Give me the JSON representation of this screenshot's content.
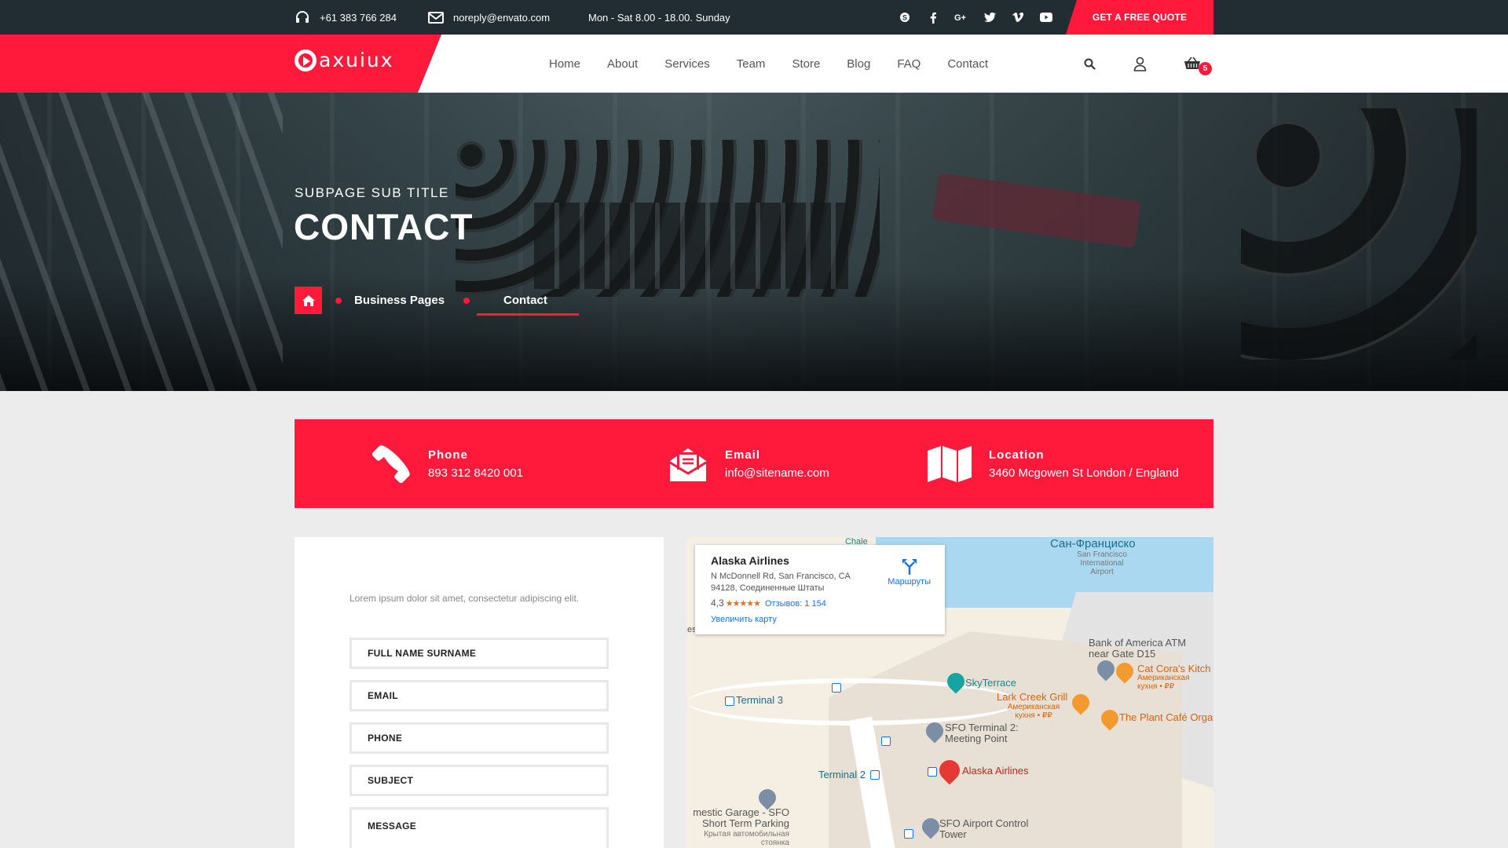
{
  "topbar": {
    "phone": "+61 383 766 284",
    "email": "noreply@envato.com",
    "hours": "Mon - Sat 8.00 - 18.00. Sunday",
    "socials": [
      "skype-icon",
      "facebook-icon",
      "google-plus-icon",
      "twitter-icon",
      "vimeo-icon",
      "youtube-icon"
    ],
    "quote_button": "GET A FREE QUOTE"
  },
  "header": {
    "logo": "axuiux",
    "nav": [
      "Home",
      "About",
      "Services",
      "Team",
      "Store",
      "Blog",
      "FAQ",
      "Contact"
    ],
    "cart_count": "5"
  },
  "hero": {
    "sub_title": "SUBPAGE SUB TITLE",
    "title": "CONTACT",
    "breadcrumb": [
      "Business Pages",
      "Contact"
    ]
  },
  "info": {
    "phone_label": "Phone",
    "phone_value": "893 312 8420 001",
    "email_label": "Email",
    "email_value": "info@sitename.com",
    "location_label": "Location",
    "location_value": "3460 Mcgowen St London / England"
  },
  "form": {
    "intro": "Lorem ipsum dolor sit amet, consectetur adipiscing elit.",
    "fields": [
      "FULL NAME SURNAME",
      "EMAIL",
      "PHONE",
      "SUBJECT",
      "MESSAGE"
    ]
  },
  "map": {
    "card_title": "Alaska Airlines",
    "card_address": "N McDonnell Rd, San Francisco, CA 94128, Соединенные Штаты",
    "rating": "4,3",
    "reviews": "Отзывов: 1 154",
    "enlarge": "Увеличить карту",
    "directions": "Маршруты",
    "labels": {
      "san_francisco": "Сан-Франциско",
      "sfo_airport_small": "San Francisco International Airport",
      "chale": "Chale",
      "bank": "Bank of America ATM near Gate D15",
      "cat_cora": "Cat Cora's Kitch",
      "cat_cora_sub": "Американская кухня • ₽₽",
      "skyterrace": "SkyTerrace",
      "lark": "Lark Creek Grill",
      "lark_sub": "Американская кухня • ₽₽",
      "plant": "The Plant Café Orga",
      "terminal3": "Terminal 3",
      "sfo_t2": "SFO Terminal 2: Meeting Point",
      "terminal2": "Terminal 2",
      "alaska": "Alaska Airlines",
      "garage": "mestic Garage - SFO Short Term Parking",
      "garage_sub": "Крытая автомобильная стоянка",
      "control_tower": "SFO Airport Control Tower",
      "es": "es"
    }
  },
  "colors": {
    "accent": "#ff1a3c",
    "topbar": "#222c33"
  }
}
